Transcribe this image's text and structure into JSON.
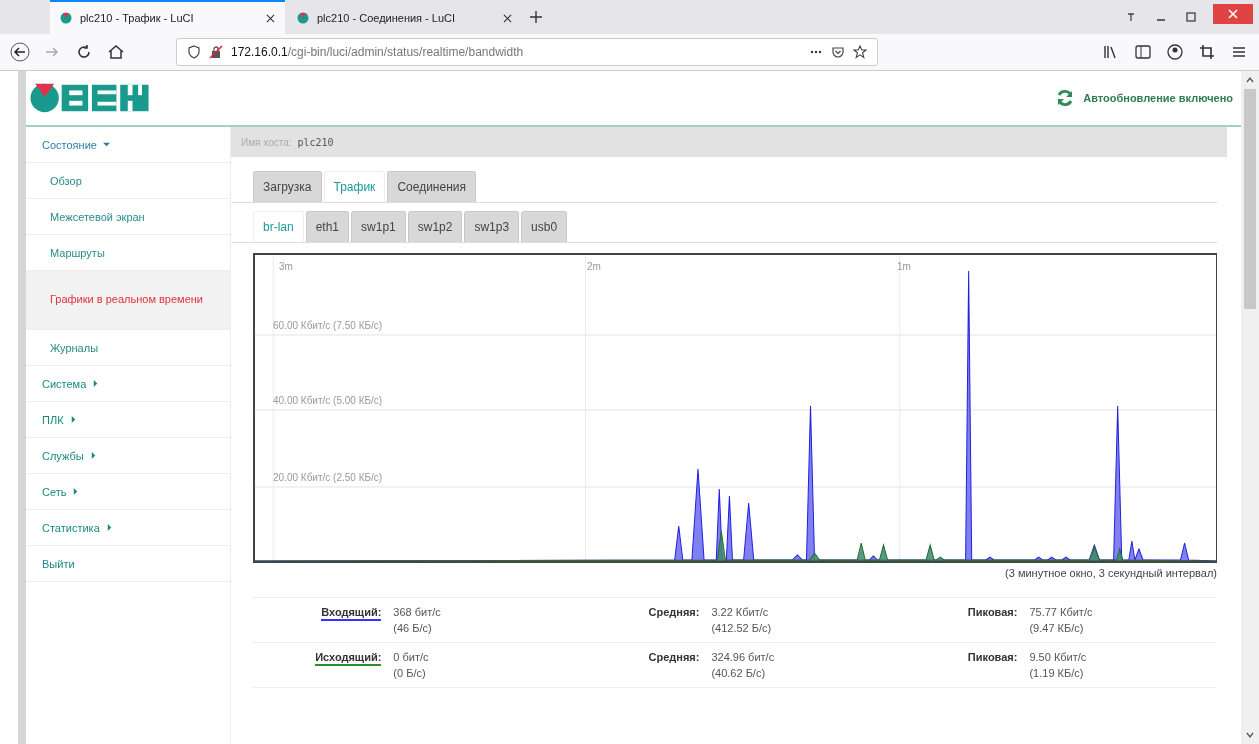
{
  "browser": {
    "tabs": [
      {
        "title": "plc210 - Трафик - LuCI",
        "selected": true
      },
      {
        "title": "plc210 - Соединения - LuCI",
        "selected": false
      }
    ],
    "url": {
      "host": "172.16.0.1",
      "path": "/cgi-bin/luci/admin/status/realtime/bandwidth"
    }
  },
  "header": {
    "autorefresh": "Автообновление включено"
  },
  "sidebar": {
    "items": [
      {
        "label": "Состояние",
        "kind": "group",
        "expanded": true,
        "children": [
          {
            "label": "Обзор",
            "selected": false
          },
          {
            "label": "Межсетевой экран",
            "selected": false
          },
          {
            "label": "Маршруты",
            "selected": false
          },
          {
            "label": "Графики в реальном времени",
            "selected": true
          },
          {
            "label": "Журналы",
            "selected": false
          }
        ]
      },
      {
        "label": "Система",
        "kind": "group",
        "expanded": false
      },
      {
        "label": "ПЛК",
        "kind": "group",
        "expanded": false
      },
      {
        "label": "Службы",
        "kind": "group",
        "expanded": false
      },
      {
        "label": "Сеть",
        "kind": "group",
        "expanded": false
      },
      {
        "label": "Статистика",
        "kind": "group",
        "expanded": false
      },
      {
        "label": "Выйти",
        "kind": "link"
      }
    ]
  },
  "host": {
    "label": "Имя хоста:",
    "value": "plc210"
  },
  "tabs": [
    {
      "label": "Загрузка",
      "selected": false
    },
    {
      "label": "Трафик",
      "selected": true
    },
    {
      "label": "Соединения",
      "selected": false
    }
  ],
  "interface_tabs": [
    {
      "label": "br-lan",
      "selected": true
    },
    {
      "label": "eth1",
      "selected": false
    },
    {
      "label": "sw1p1",
      "selected": false
    },
    {
      "label": "sw1p2",
      "selected": false
    },
    {
      "label": "sw1p3",
      "selected": false
    },
    {
      "label": "usb0",
      "selected": false
    }
  ],
  "graph": {
    "time_labels": [
      "3m",
      "2m",
      "1m"
    ],
    "rate_labels": [
      "60.00 Кбит/с (7.50 КБ/с)",
      "40.00 Кбит/с (5.00 КБ/с)",
      "20.00 Кбит/с (2.50 КБ/с)"
    ],
    "caption": "(3 минутное окно, 3 секундный интервал)"
  },
  "stats": [
    {
      "label": "Входящий:",
      "color": "#3333ff",
      "value": "368 бит/с",
      "value_bytes": "(46 Б/с)",
      "avg_label": "Средняя:",
      "avg": "3.22 Кбит/с",
      "avg_bytes": "(412.52 Б/с)",
      "peak_label": "Пиковая:",
      "peak": "75.77 Кбит/с",
      "peak_bytes": "(9.47 КБ/с)"
    },
    {
      "label": "Исходящий:",
      "color": "#2e8b2e",
      "value": "0 бит/с",
      "value_bytes": "(0 Б/с)",
      "avg_label": "Средняя:",
      "avg": "324.96 бит/с",
      "avg_bytes": "(40.62 Б/с)",
      "peak_label": "Пиковая:",
      "peak": "9.50 Кбит/с",
      "peak_bytes": "(1.19 КБ/с)"
    }
  ]
}
